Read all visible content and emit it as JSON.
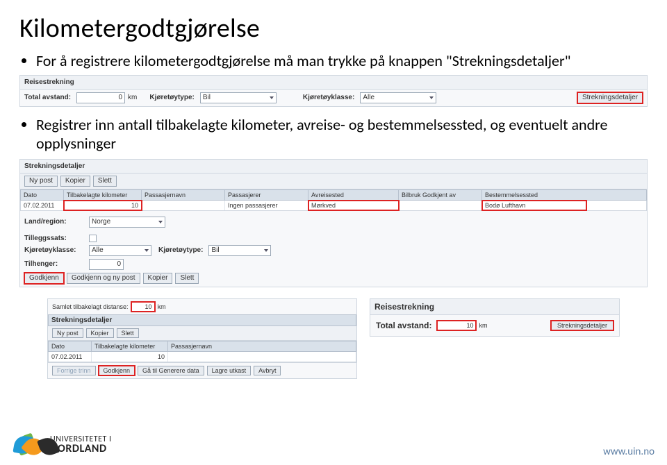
{
  "title": "Kilometergodtgjørelse",
  "bullets": {
    "b1": "For å registrere kilometergodtgjørelse må man trykke på knappen \"Strekningsdetaljer\"",
    "b2": "Registrer inn antall tilbakelagte kilometer, avreise- og bestemmelsessted, og eventuelt andre opplysninger"
  },
  "reisestrekning": {
    "title": "Reisestrekning",
    "total_lbl": "Total avstand:",
    "total_val": "0",
    "km_unit": "km",
    "type_lbl": "Kjøretøytype:",
    "type_val": "Bil",
    "class_lbl": "Kjøretøyklasse:",
    "class_val": "Alle",
    "details_btn": "Strekningsdetaljer"
  },
  "detaljer": {
    "title": "Strekningsdetaljer",
    "new_btn": "Ny post",
    "copy_btn": "Kopier",
    "del_btn": "Slett",
    "cols": {
      "date": "Dato",
      "km": "Tilbakelagte kilometer",
      "pname": "Passasjernavn",
      "pass": "Passasjerer",
      "avr": "Avreisested",
      "bilb": "Bilbruk Godkjent av",
      "best": "Bestemmelsessted"
    },
    "row": {
      "date": "07.02.2011",
      "km": "10",
      "pass": "Ingen passasjerer",
      "avr": "Mørkved",
      "best": "Bodø Lufthavn"
    },
    "land_lbl": "Land/region:",
    "land_val": "Norge",
    "tillegg_lbl": "Tilleggssats:",
    "class_lbl": "Kjøretøyklasse:",
    "class_val": "Alle",
    "type_lbl": "Kjøretøytype:",
    "type_val": "Bil",
    "trailer_lbl": "Tilhenger:",
    "trailer_val": "0",
    "approve_btn": "Godkjenn",
    "approve_new_btn": "Godkjenn og ny post",
    "copy2_btn": "Kopier",
    "del2_btn": "Slett"
  },
  "inset_left": {
    "samlet_lbl": "Samlet tilbakelagt distanse:",
    "samlet_val": "10",
    "km": "km",
    "sd_title": "Strekningsdetaljer",
    "new_btn": "Ny post",
    "copy_btn": "Kopier",
    "del_btn": "Slett",
    "c_date": "Dato",
    "c_km": "Tilbakelagte kilometer",
    "c_pname": "Passasjernavn",
    "r_date": "07.02.2011",
    "r_km": "10",
    "prev_btn": "Forrige trinn",
    "approve_btn": "Godkjenn",
    "gen_btn": "Gå til Generere data",
    "draft_btn": "Lagre utkast",
    "cancel_btn": "Avbryt"
  },
  "inset_right": {
    "title": "Reisestrekning",
    "total_lbl": "Total avstand:",
    "total_val": "10",
    "km": "km",
    "details_btn": "Strekningsdetaljer"
  },
  "footer": {
    "logo1": "UNIVERSITETET I",
    "logo2": "NORDLAND",
    "url": "www.uin.no"
  }
}
